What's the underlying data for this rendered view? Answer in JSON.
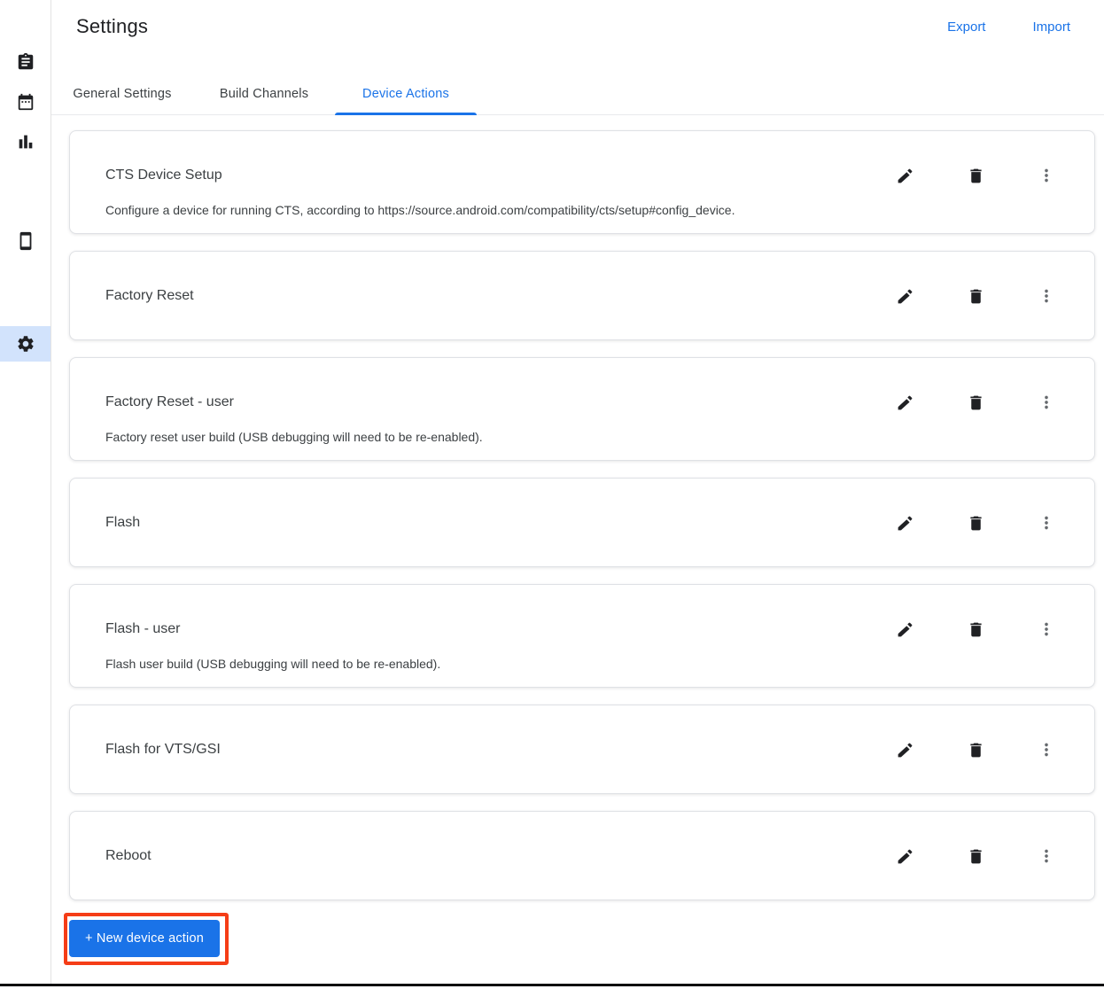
{
  "colors": {
    "accent": "#1a73e8",
    "annotation_highlight": "#f53d17",
    "sidebar_selected_bg": "#d2e3fc"
  },
  "sidebar": {
    "items": [
      {
        "icon": "clipboard-icon",
        "selected": false
      },
      {
        "icon": "calendar-icon",
        "selected": false
      },
      {
        "icon": "bar-chart-icon",
        "selected": false
      },
      {
        "icon": "smartphone-icon",
        "selected": false
      },
      {
        "icon": "gear-icon",
        "selected": true
      }
    ]
  },
  "header": {
    "title": "Settings",
    "actions": [
      {
        "label": "Export"
      },
      {
        "label": "Import"
      }
    ]
  },
  "tabs": [
    {
      "label": "General Settings",
      "active": false
    },
    {
      "label": "Build Channels",
      "active": false
    },
    {
      "label": "Device Actions",
      "active": true
    }
  ],
  "device_actions": {
    "cards": [
      {
        "title": "CTS Device Setup",
        "description": "Configure a device for running CTS, according to https://source.android.com/compatibility/cts/setup#config_device."
      },
      {
        "title": "Factory Reset",
        "description": ""
      },
      {
        "title": "Factory Reset - user",
        "description": "Factory reset user build (USB debugging will need to be re-enabled)."
      },
      {
        "title": "Flash",
        "description": ""
      },
      {
        "title": "Flash - user",
        "description": "Flash user build (USB debugging will need to be re-enabled)."
      },
      {
        "title": "Flash for VTS/GSI",
        "description": ""
      },
      {
        "title": "Reboot",
        "description": ""
      }
    ],
    "card_action_icons": [
      {
        "icon": "edit-pencil-icon"
      },
      {
        "icon": "delete-trash-icon"
      },
      {
        "icon": "more-vert-icon"
      }
    ],
    "new_button_label": "+ New device action"
  }
}
